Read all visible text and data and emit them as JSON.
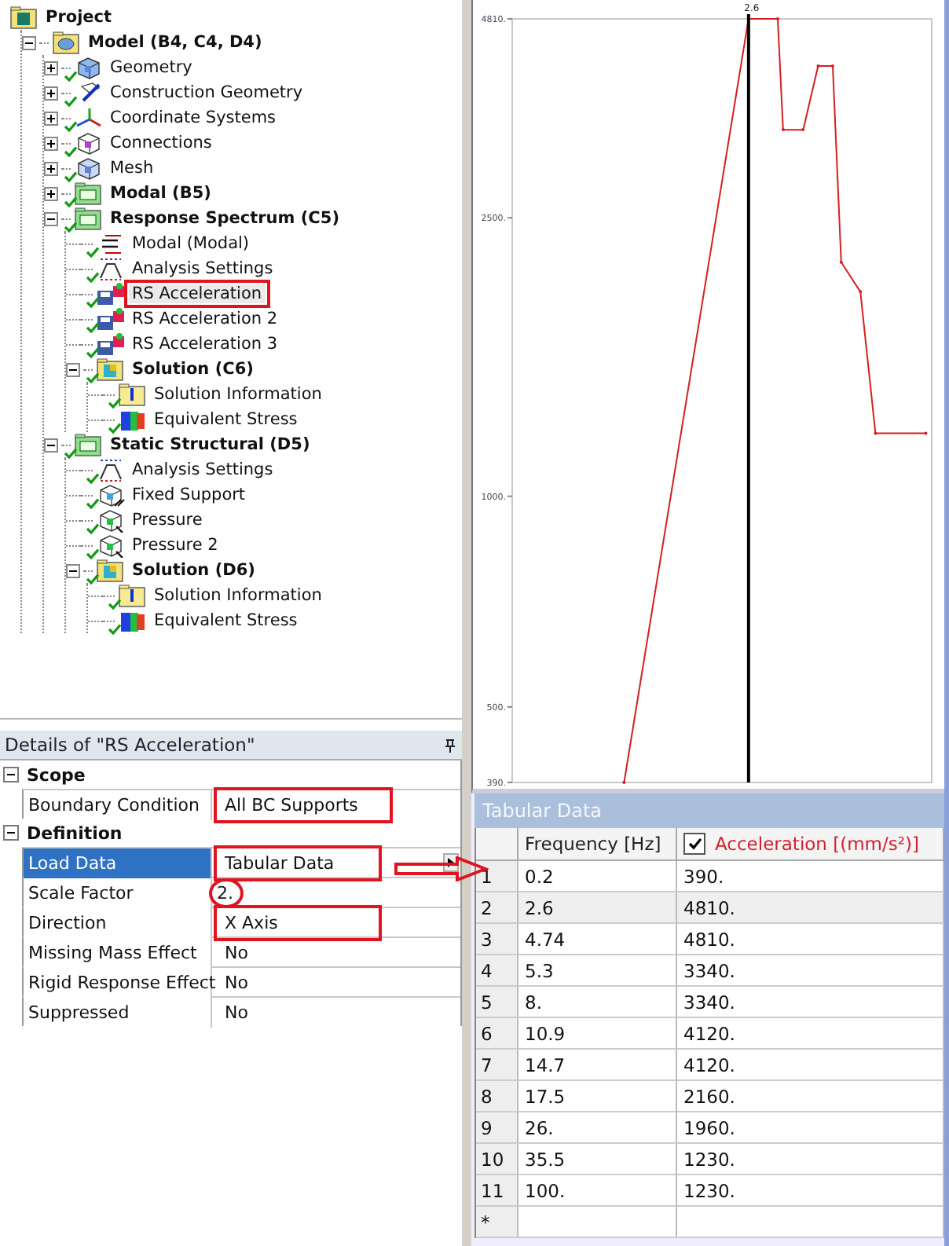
{
  "tree": [
    {
      "label": "Project",
      "kind": "project",
      "children": [
        {
          "label": "Model (B4, C4, D4)",
          "kind": "model",
          "expanded": true,
          "children": [
            {
              "label": "Geometry",
              "kind": "geometry",
              "expanded": false,
              "solved": true
            },
            {
              "label": "Construction Geometry",
              "kind": "construction",
              "expanded": false,
              "solved": true
            },
            {
              "label": "Coordinate Systems",
              "kind": "coordinates",
              "expanded": false,
              "solved": true
            },
            {
              "label": "Connections",
              "kind": "connections",
              "expanded": false,
              "solved": true
            },
            {
              "label": "Mesh",
              "kind": "mesh",
              "expanded": false,
              "solved": true
            },
            {
              "label": "Modal (B5)",
              "kind": "analysis",
              "expanded": false,
              "solved": true
            },
            {
              "label": "Response Spectrum (C5)",
              "kind": "analysis",
              "expanded": true,
              "solved": true,
              "children": [
                {
                  "label": "Modal (Modal)",
                  "kind": "environment",
                  "solved": true
                },
                {
                  "label": "Analysis Settings",
                  "kind": "settings",
                  "solved": true
                },
                {
                  "label": "RS Acceleration",
                  "kind": "load",
                  "solved": true,
                  "boxed": true
                },
                {
                  "label": "RS Acceleration 2",
                  "kind": "load",
                  "solved": true
                },
                {
                  "label": "RS Acceleration 3",
                  "kind": "load",
                  "solved": true
                },
                {
                  "label": "Solution (C6)",
                  "kind": "solution",
                  "expanded": true,
                  "solved": true,
                  "children": [
                    {
                      "label": "Solution Information",
                      "kind": "info",
                      "solved": true
                    },
                    {
                      "label": "Equivalent Stress",
                      "kind": "result",
                      "solved": true
                    }
                  ]
                }
              ]
            },
            {
              "label": "Static Structural (D5)",
              "kind": "analysis",
              "expanded": true,
              "solved": true,
              "children": [
                {
                  "label": "Analysis Settings",
                  "kind": "settings",
                  "solved": true
                },
                {
                  "label": "Fixed Support",
                  "kind": "support",
                  "solved": true
                },
                {
                  "label": "Pressure",
                  "kind": "pressure",
                  "solved": true
                },
                {
                  "label": "Pressure 2",
                  "kind": "pressure",
                  "solved": true
                },
                {
                  "label": "Solution (D6)",
                  "kind": "solution",
                  "expanded": true,
                  "solved": true,
                  "children": [
                    {
                      "label": "Solution Information",
                      "kind": "info",
                      "solved": true
                    },
                    {
                      "label": "Equivalent Stress",
                      "kind": "result",
                      "solved": true
                    }
                  ]
                }
              ]
            }
          ]
        }
      ]
    }
  ],
  "details": {
    "title": "Details of \"RS Acceleration\"",
    "sections": [
      {
        "label": "Scope",
        "expanded": true,
        "rows": [
          {
            "label": "Boundary Condition",
            "value": "All BC Supports",
            "selected": false,
            "boxed": true
          }
        ]
      },
      {
        "label": "Definition",
        "expanded": true,
        "rows": [
          {
            "label": "Load Data",
            "value": "Tabular Data",
            "selected": true,
            "boxed": true,
            "arrow": true
          },
          {
            "label": "Scale Factor",
            "value": "2.",
            "selected": false,
            "circled": true
          },
          {
            "label": "Direction",
            "value": "X Axis",
            "selected": false,
            "boxed": true
          },
          {
            "label": "Missing Mass Effect",
            "value": "No",
            "selected": false
          },
          {
            "label": "Rigid Response Effect",
            "value": "No",
            "selected": false
          },
          {
            "label": "Suppressed",
            "value": "No",
            "selected": false
          }
        ]
      }
    ]
  },
  "graph": {
    "cursor_label": "2.6",
    "y_axis_labels": [
      "4810.",
      "2500.",
      "1000.",
      "500.",
      "390."
    ]
  },
  "tabular": {
    "title": "Tabular Data",
    "columns": [
      {
        "label": "Frequency [Hz]"
      },
      {
        "label": "Acceleration [(mm/s²)]",
        "checked": true
      }
    ],
    "rows": [
      {
        "index": "1",
        "frequency": "0.2",
        "acceleration": "390.",
        "selected": false
      },
      {
        "index": "2",
        "frequency": "2.6",
        "acceleration": "4810.",
        "selected": true
      },
      {
        "index": "3",
        "frequency": "4.74",
        "acceleration": "4810.",
        "selected": false
      },
      {
        "index": "4",
        "frequency": "5.3",
        "acceleration": "3340.",
        "selected": false
      },
      {
        "index": "5",
        "frequency": "8.",
        "acceleration": "3340.",
        "selected": false
      },
      {
        "index": "6",
        "frequency": "10.9",
        "acceleration": "4120.",
        "selected": false
      },
      {
        "index": "7",
        "frequency": "14.7",
        "acceleration": "4120.",
        "selected": false
      },
      {
        "index": "8",
        "frequency": "17.5",
        "acceleration": "2160.",
        "selected": false
      },
      {
        "index": "9",
        "frequency": "26.",
        "acceleration": "1960.",
        "selected": false
      },
      {
        "index": "10",
        "frequency": "35.5",
        "acceleration": "1230.",
        "selected": false
      },
      {
        "index": "11",
        "frequency": "100.",
        "acceleration": "1230.",
        "selected": false
      }
    ],
    "new_row_marker": "*"
  }
}
